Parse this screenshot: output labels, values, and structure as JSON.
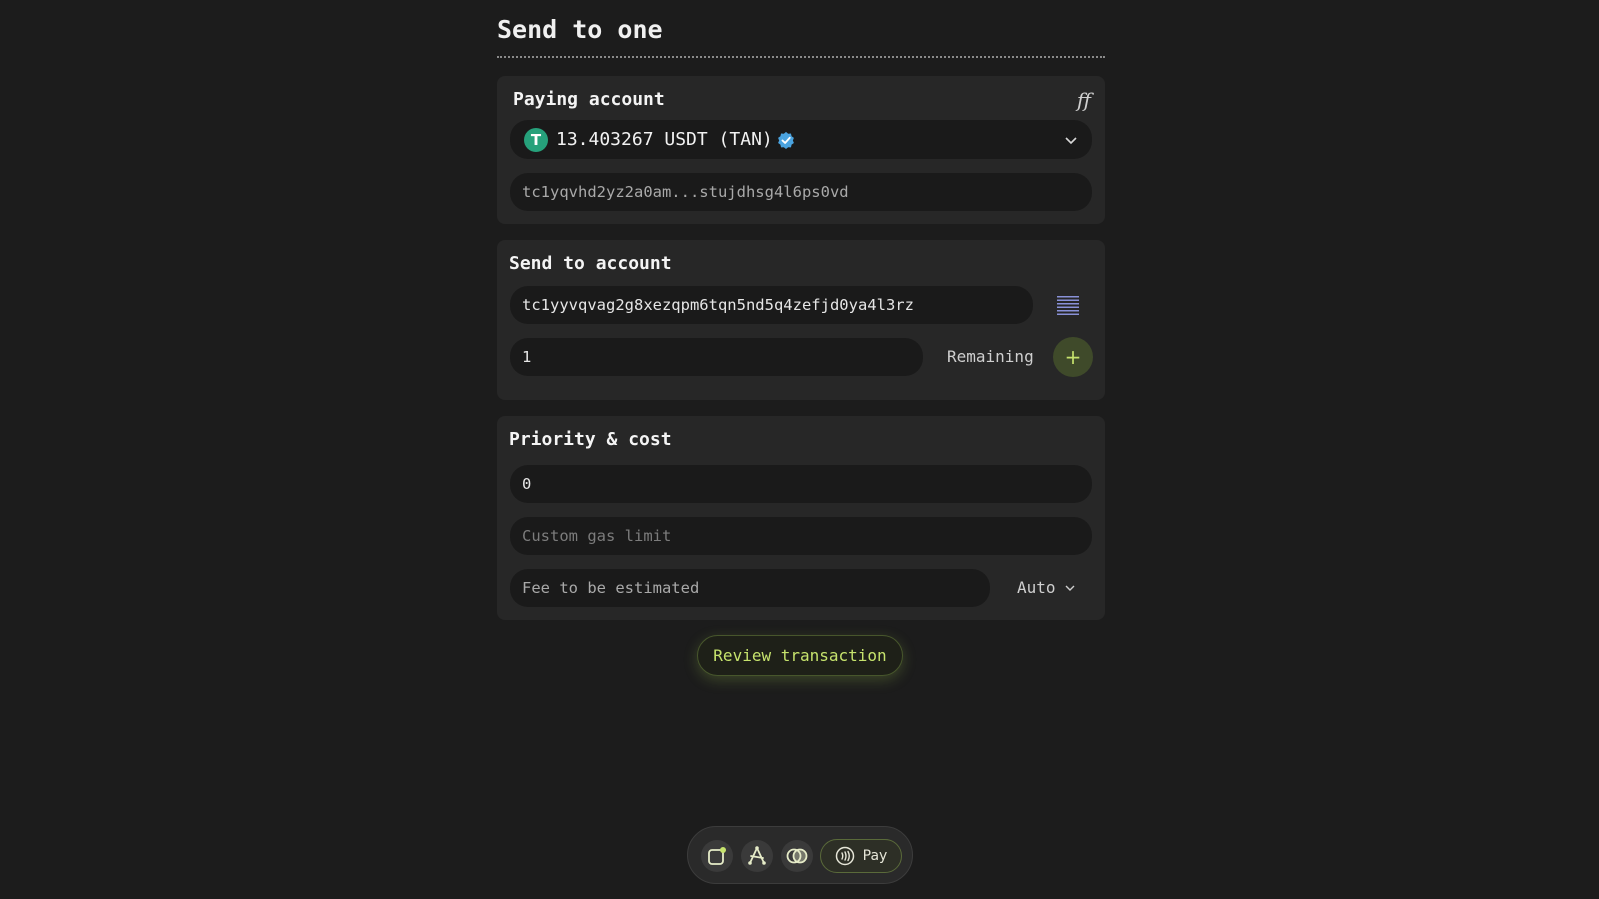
{
  "page": {
    "title": "Send to one"
  },
  "paying_account": {
    "title": "Paying account",
    "header_icon": "ff-icon",
    "token_icon_letter": "T",
    "balance": "13.403267 USDT (TAN)",
    "address": "tc1yqvhd2yz2a0am...stujdhsg4l6ps0vd",
    "token_color": "#26a17b"
  },
  "send_to": {
    "title": "Send to account",
    "recipient_value": "tc1yyvqvag2g8xezqpm6tqn5nd5q4zefjd0ya4l3rz",
    "amount_value": "1",
    "remaining_label": "Remaining",
    "add_label": "+"
  },
  "priority": {
    "title": "Priority & cost",
    "priority_value": "0",
    "gas_placeholder": "Custom gas limit",
    "fee_label": "Fee to be estimated",
    "mode_label": "Auto"
  },
  "actions": {
    "review_label": "Review transaction"
  },
  "dock": {
    "pay_label": "Pay",
    "accent": "#c6e36d"
  }
}
